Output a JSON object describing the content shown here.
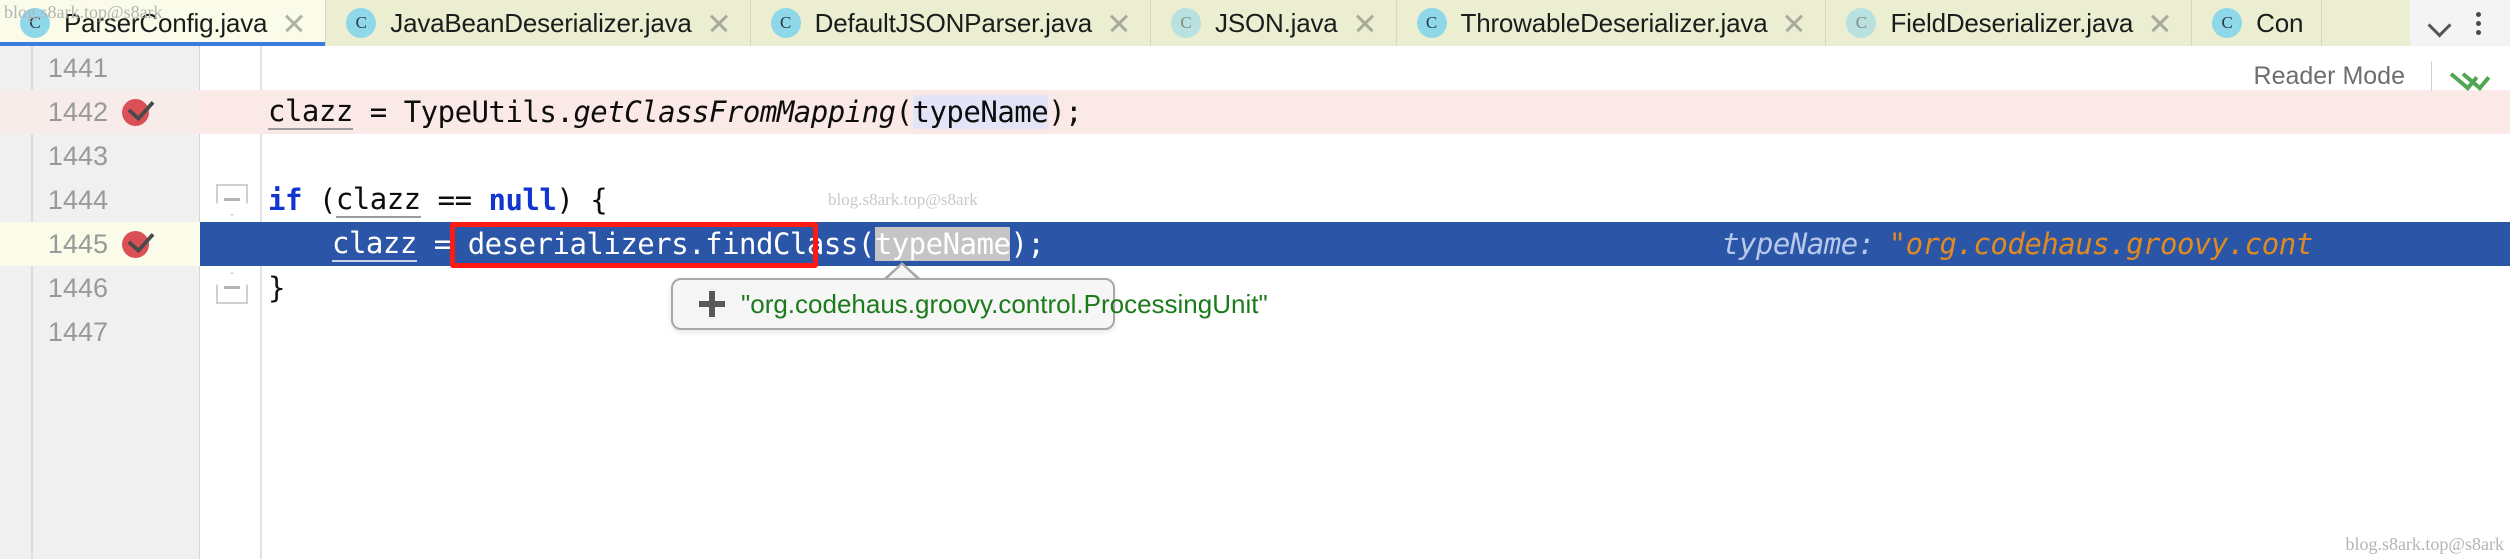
{
  "tabbar": {
    "tabs": [
      {
        "label": "ParserConfig.java",
        "icon": "java-class-icon",
        "active": true,
        "muted": false
      },
      {
        "label": "JavaBeanDeserializer.java",
        "icon": "java-class-icon",
        "active": false,
        "muted": false
      },
      {
        "label": "DefaultJSONParser.java",
        "icon": "java-class-icon",
        "active": false,
        "muted": false
      },
      {
        "label": "JSON.java",
        "icon": "java-class-icon",
        "active": false,
        "muted": true
      },
      {
        "label": "ThrowableDeserializer.java",
        "icon": "java-class-icon",
        "active": false,
        "muted": false
      },
      {
        "label": "FieldDeserializer.java",
        "icon": "java-class-icon",
        "active": false,
        "muted": true
      },
      {
        "label": "Con",
        "icon": "java-class-icon",
        "active": false,
        "muted": false
      }
    ],
    "close_icon": "close-icon",
    "overflow_icon": "chevron-down-icon",
    "more_icon": "kebab-menu-icon"
  },
  "editor": {
    "reader_mode": {
      "label": "Reader Mode",
      "status_icon": "double-check-icon"
    },
    "lines": [
      {
        "number": "1441",
        "breakpoint": false,
        "state": "normal",
        "text": ""
      },
      {
        "number": "1442",
        "breakpoint": true,
        "state": "breakpoint",
        "text": "clazz = TypeUtils.getClassFromMapping(typeName);",
        "tokens": {
          "var": "clazz",
          "eq": " = ",
          "cls": "TypeUtils.",
          "method": "getClassFromMapping",
          "open": "(",
          "param": "typeName",
          "close": ");"
        }
      },
      {
        "number": "1443",
        "breakpoint": false,
        "state": "normal",
        "text": ""
      },
      {
        "number": "1444",
        "breakpoint": false,
        "state": "normal",
        "text": "if (clazz == null) {",
        "tokens": {
          "kw_if": "if",
          "paren_open": " (",
          "var": "clazz",
          "op": " == ",
          "kw_null": "null",
          "tail": ") {"
        }
      },
      {
        "number": "1445",
        "breakpoint": true,
        "state": "executing",
        "text": "clazz = deserializers.findClass(typeName);",
        "tokens": {
          "var": "clazz",
          "eq": " = ",
          "expr": "deserializers.findClass",
          "open": "(",
          "param": "typeName",
          "close": ");"
        },
        "inline_hint": {
          "name": "typeName:",
          "value": "\"org.codehaus.groovy.cont"
        }
      },
      {
        "number": "1446",
        "breakpoint": false,
        "state": "normal",
        "text": "}"
      },
      {
        "number": "1447",
        "breakpoint": false,
        "state": "normal",
        "text": ""
      }
    ],
    "fold_markers": [
      {
        "type": "fold-open-icon",
        "line": "1444"
      },
      {
        "type": "fold-close-icon",
        "line": "1446"
      }
    ],
    "annotation": {
      "type": "red-highlight-box",
      "target_text": "deserializers.findClass"
    }
  },
  "tooltip": {
    "expander_icon": "plus-icon",
    "value": "\"org.codehaus.groovy.control.ProcessingUnit\""
  },
  "watermarks": {
    "top_left": "blog.s8ark.top@s8ark",
    "center": "blog.s8ark.top@s8ark",
    "bottom_right": "blog.s8ark.top@s8ark"
  },
  "colors": {
    "tab_bar_bg": "#eceed2",
    "active_tab_bg": "#fafbe8",
    "active_tab_underline": "#3b7ddd",
    "breakpoint_line_bg": "#fbe9e7",
    "executing_line_bg": "#2b55a6",
    "annotation_red": "#ff1a12",
    "string_green": "#1b7b1b",
    "hint_orange": "#e08a21",
    "keyword_blue": "#1335cf"
  }
}
